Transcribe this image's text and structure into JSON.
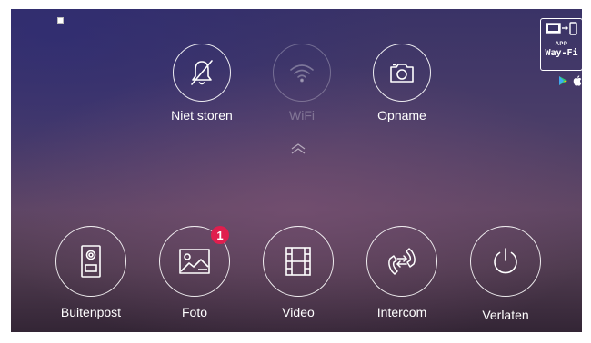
{
  "top_buttons": [
    {
      "label": "Niet storen",
      "icon": "bell-off-icon",
      "enabled": true
    },
    {
      "label": "WiFi",
      "icon": "wifi-icon",
      "enabled": false
    },
    {
      "label": "Opname",
      "icon": "camera-icon",
      "enabled": true
    }
  ],
  "bottom_buttons": [
    {
      "label": "Buitenpost",
      "icon": "door-station-icon"
    },
    {
      "label": "Foto",
      "icon": "photo-icon",
      "badge": "1"
    },
    {
      "label": "Video",
      "icon": "film-icon"
    },
    {
      "label": "Intercom",
      "icon": "intercom-icon"
    },
    {
      "label": "Verlaten",
      "icon": "power-icon"
    }
  ],
  "wayfi_badge": {
    "app_text": "APP",
    "brand_text": "Way-Fi"
  },
  "colors": {
    "badge": "#e01e4e",
    "icon": "#ffffff"
  }
}
